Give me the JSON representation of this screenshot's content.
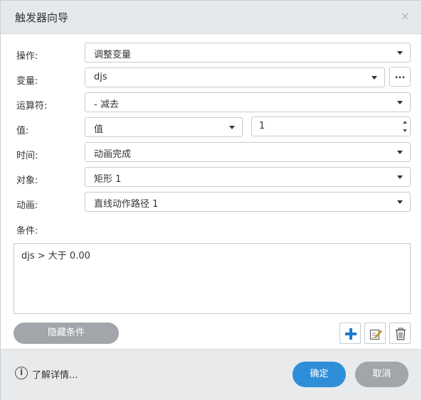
{
  "dialog": {
    "title": "触发器向导",
    "close_glyph": "×"
  },
  "fields": {
    "operation": {
      "label": "操作:",
      "value": "调整变量"
    },
    "variable": {
      "label": "变量:",
      "value": "djs",
      "more_label": "..."
    },
    "operator": {
      "label": "运算符:",
      "value": "- 减去"
    },
    "value": {
      "label": "值:",
      "type_value": "值",
      "number": "1"
    },
    "time": {
      "label": "时间:",
      "value": "动画完成"
    },
    "target": {
      "label": "对象:",
      "value": "矩形 1"
    },
    "animation": {
      "label": "动画:",
      "value": "直线动作路径 1"
    },
    "conditions": {
      "label": "条件:",
      "items": [
        "djs > 大于 0.00"
      ]
    }
  },
  "actions": {
    "hide_conditions": "隐藏条件",
    "add_icon": "plus-icon",
    "edit_icon": "edit-icon",
    "delete_icon": "trash-icon"
  },
  "footer": {
    "learn_more": "了解详情...",
    "info_icon": "i",
    "ok": "确定",
    "cancel": "取消"
  },
  "colors": {
    "primary": "#2e8fd8",
    "add": "#1a7ad0",
    "secondary": "#a2a6ab"
  }
}
